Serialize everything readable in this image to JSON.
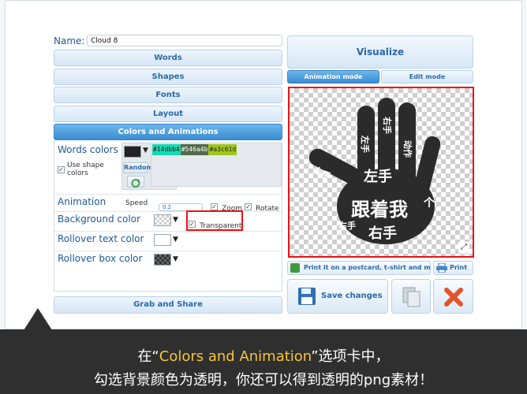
{
  "name_field": {
    "label": "Name:",
    "value": "Cloud 8"
  },
  "sections": [
    "Words",
    "Shapes",
    "Fonts",
    "Layout",
    "Colors and Animations"
  ],
  "colors_panel": {
    "words_colors_label": "Words colors",
    "use_shape_colors": "Use shape colors",
    "random_label": "Random",
    "palette": [
      {
        "hex": "#14dbb4",
        "color": "#14dbb4"
      },
      {
        "hex": "#546a4b",
        "color": "#546a4b"
      },
      {
        "hex": "#a3c61d",
        "color": "#a3c61d"
      }
    ],
    "animation_label": "Animation",
    "speed_label": "Speed",
    "speed_value": "0.2",
    "zoom_label": "Zoom",
    "rotate_label": "Rotate",
    "background_color_label": "Background color",
    "transparent_label": "Transparent",
    "rollover_text_color_label": "Rollover text color",
    "rollover_box_color_label": "Rollover box color"
  },
  "grab_share_label": "Grab and Share",
  "visualize_label": "Visualize",
  "modes": {
    "animation": "Animation mode",
    "edit": "Edit mode"
  },
  "canvas_words": [
    "跟着我",
    "左手",
    "右手",
    "左手",
    "右手",
    "左手",
    "右手",
    "动作",
    "个"
  ],
  "actions": {
    "print_postcard": "Print it on a postcard, t-shirt and more",
    "print": "Print",
    "save_changes": "Save changes"
  },
  "caption": {
    "line1_prefix": "在“",
    "line1_highlight": "Colors and Animation",
    "line1_suffix": "”选项卡中，",
    "line2": "勾选背景颜色为透明，你还可以得到透明的png素材！"
  }
}
